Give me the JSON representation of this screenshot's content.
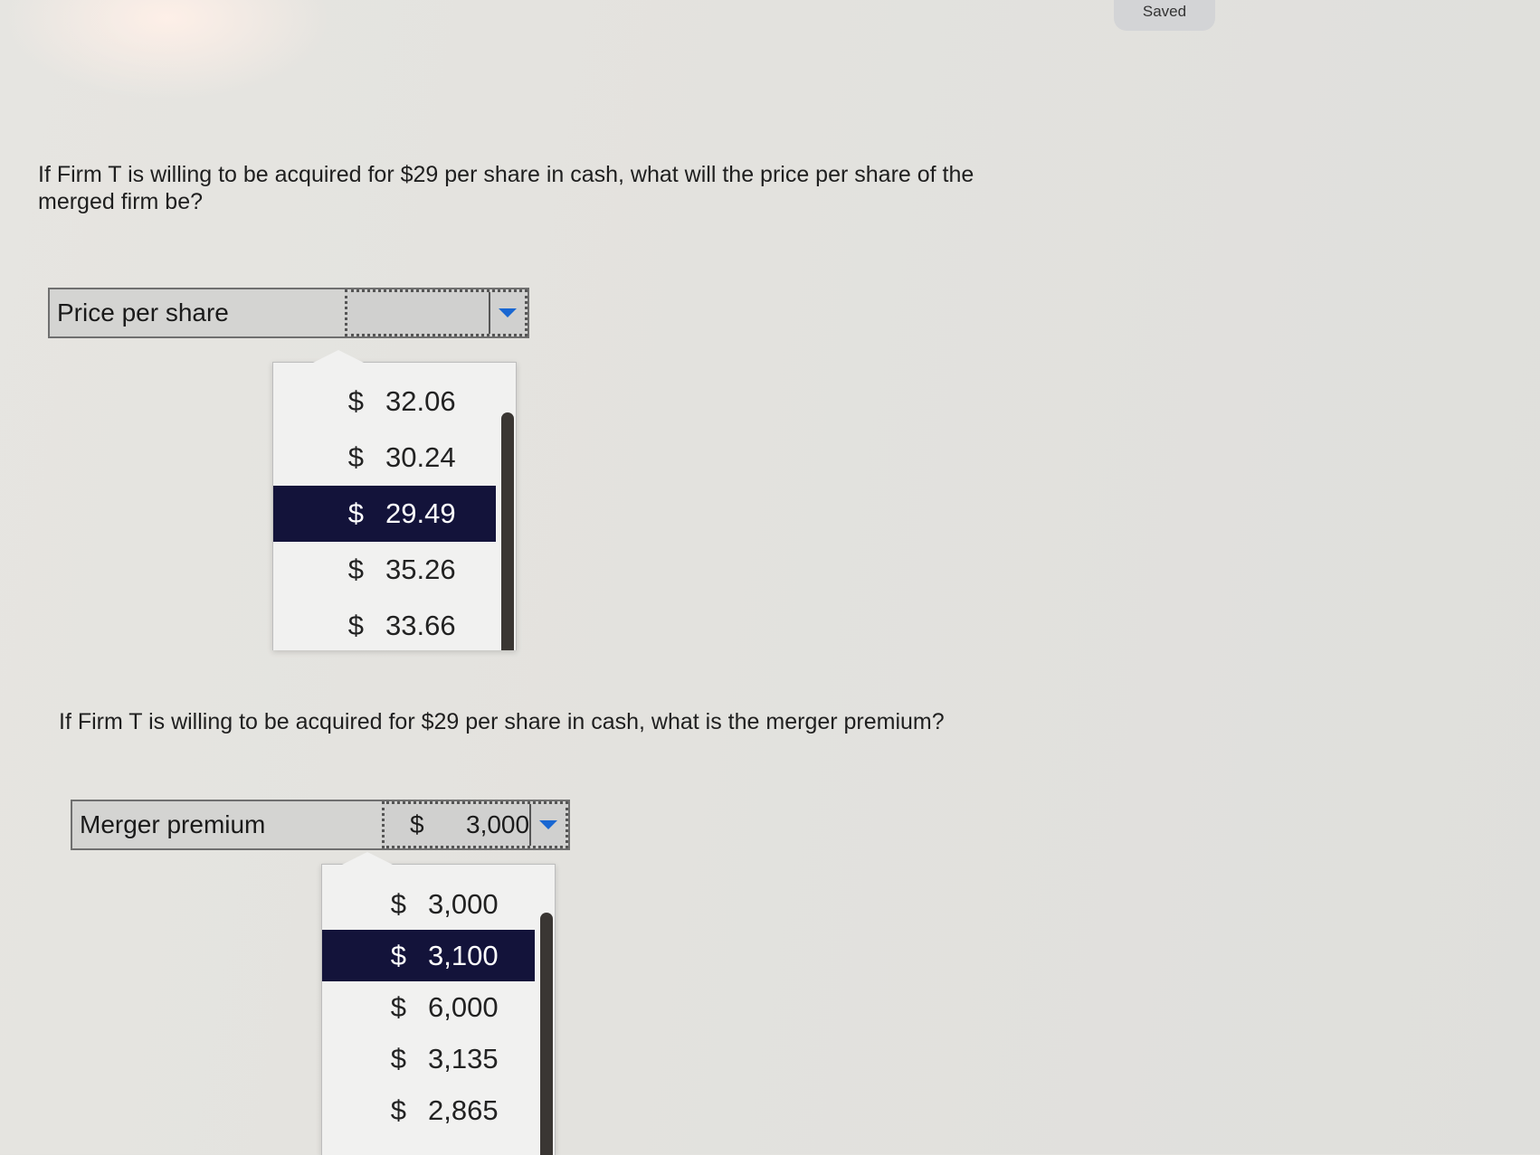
{
  "status": {
    "saved_label": "Saved"
  },
  "question1": {
    "prompt": "If Firm T is willing to be acquired for $29 per share in cash, what will the price per share of the merged firm be?",
    "row_label": "Price per share",
    "selected_dollar": "",
    "selected_value": "",
    "options": [
      {
        "dollar": "$",
        "value": "32.06"
      },
      {
        "dollar": "$",
        "value": "30.24"
      },
      {
        "dollar": "$",
        "value": "29.49"
      },
      {
        "dollar": "$",
        "value": "35.26"
      },
      {
        "dollar": "$",
        "value": "33.66"
      }
    ],
    "highlighted_index": 2
  },
  "question2": {
    "prompt": "If Firm T is willing to be acquired for $29 per share in cash, what is the merger premium?",
    "row_label": "Merger premium",
    "selected_dollar": "$",
    "selected_value": "3,000",
    "options": [
      {
        "dollar": "$",
        "value": "3,000"
      },
      {
        "dollar": "$",
        "value": "3,100"
      },
      {
        "dollar": "$",
        "value": "6,000"
      },
      {
        "dollar": "$",
        "value": "3,135"
      },
      {
        "dollar": "$",
        "value": "2,865"
      }
    ],
    "highlighted_index": 1
  },
  "colors": {
    "highlight": "#13133a",
    "arrow": "#1967d2"
  }
}
